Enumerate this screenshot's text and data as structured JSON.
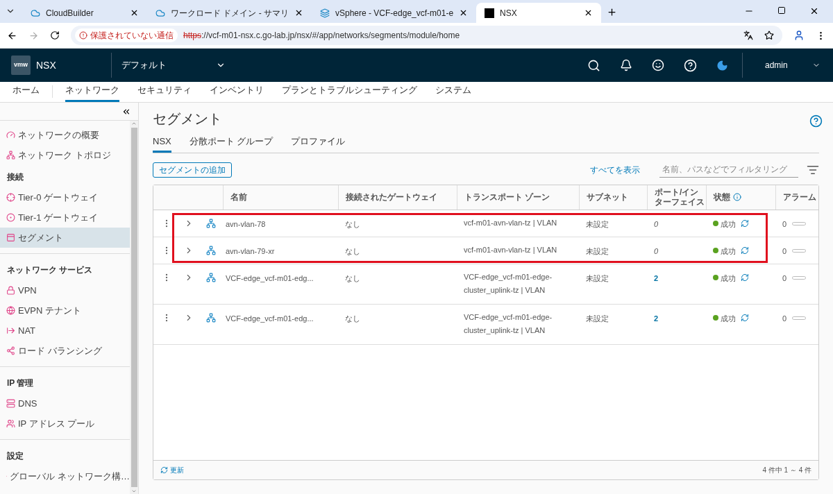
{
  "browser": {
    "tabs": [
      {
        "title": "CloudBuilder",
        "selected": false
      },
      {
        "title": "ワークロード ドメイン - サマリ",
        "selected": false
      },
      {
        "title": "vSphere - VCF-edge_vcf-m01-e",
        "selected": false
      },
      {
        "title": "NSX",
        "selected": true
      }
    ],
    "security_warning": "保護されていない通信",
    "url_scheme": "https",
    "url_rest": "://vcf-m01-nsx.c.go-lab.jp/nsx/#/app/networks/segments/module/home"
  },
  "header": {
    "logo": "vmw",
    "product": "NSX",
    "project": "デフォルト",
    "user": "admin"
  },
  "nav": [
    {
      "label": "ホーム",
      "selected": false
    },
    {
      "label": "ネットワーク",
      "selected": true
    },
    {
      "label": "セキュリティ",
      "selected": false
    },
    {
      "label": "インベントリ",
      "selected": false
    },
    {
      "label": "プランとトラブルシューティング",
      "selected": false
    },
    {
      "label": "システム",
      "selected": false
    }
  ],
  "sidebar": {
    "sections": [
      {
        "items": [
          {
            "label": "ネットワークの概要",
            "selected": false
          },
          {
            "label": "ネットワーク トポロジ",
            "selected": false
          }
        ]
      },
      {
        "title": "接続",
        "items": [
          {
            "label": "Tier-0 ゲートウェイ",
            "selected": false
          },
          {
            "label": "Tier-1 ゲートウェイ",
            "selected": false
          },
          {
            "label": "セグメント",
            "selected": true
          }
        ]
      },
      {
        "title": "ネットワーク サービス",
        "items": [
          {
            "label": "VPN",
            "selected": false
          },
          {
            "label": "EVPN テナント",
            "selected": false
          },
          {
            "label": "NAT",
            "selected": false
          },
          {
            "label": "ロード バランシング",
            "selected": false
          }
        ]
      },
      {
        "title": "IP 管理",
        "items": [
          {
            "label": "DNS",
            "selected": false
          },
          {
            "label": "IP アドレス プール",
            "selected": false
          }
        ]
      },
      {
        "title": "設定",
        "items": [
          {
            "label": "グローバル ネットワーク構…",
            "selected": false
          }
        ]
      }
    ]
  },
  "page": {
    "title": "セグメント",
    "tabs": [
      {
        "label": "NSX",
        "selected": true
      },
      {
        "label": "分散ポート グループ",
        "selected": false
      },
      {
        "label": "プロファイル",
        "selected": false
      }
    ],
    "add_button": "セグメントの追加",
    "show_all": "すべてを表示",
    "filter": {
      "placeholder": "名前、パスなどでフィルタリング"
    }
  },
  "table": {
    "columns": [
      "名前",
      "接続されたゲートウェイ",
      "トランスポート ゾーン",
      "サブネット",
      "ポート/インターフェイス",
      "状態",
      "アラーム"
    ],
    "rows": [
      {
        "name": "avn-vlan-78",
        "gateway": "なし",
        "transport_zone": "vcf-m01-avn-vlan-tz | VLAN",
        "subnet": "未設定",
        "ports": "0",
        "ports_link": false,
        "status": "成功",
        "color": "#5aa220",
        "alarms": "0",
        "highlighted": true
      },
      {
        "name": "avn-vlan-79-xr",
        "gateway": "なし",
        "transport_zone": "vcf-m01-avn-vlan-tz | VLAN",
        "subnet": "未設定",
        "ports": "0",
        "ports_link": false,
        "status": "成功",
        "color": "#5aa220",
        "alarms": "0",
        "highlighted": true
      },
      {
        "name": "VCF-edge_vcf-m01-edg...",
        "gateway": "なし",
        "transport_zone": "VCF-edge_vcf-m01-edge-cluster_uplink-tz | VLAN",
        "subnet": "未設定",
        "ports": "2",
        "ports_link": true,
        "status": "成功",
        "color": "#5aa220",
        "alarms": "0",
        "highlighted": false
      },
      {
        "name": "VCF-edge_vcf-m01-edg...",
        "gateway": "なし",
        "transport_zone": "VCF-edge_vcf-m01-edge-cluster_uplink-tz | VLAN",
        "subnet": "未設定",
        "ports": "2",
        "ports_link": true,
        "status": "成功",
        "color": "#5aa220",
        "alarms": "0",
        "highlighted": false
      }
    ],
    "refresh": "更新",
    "count": "4 件中 1 ～ 4 件"
  }
}
